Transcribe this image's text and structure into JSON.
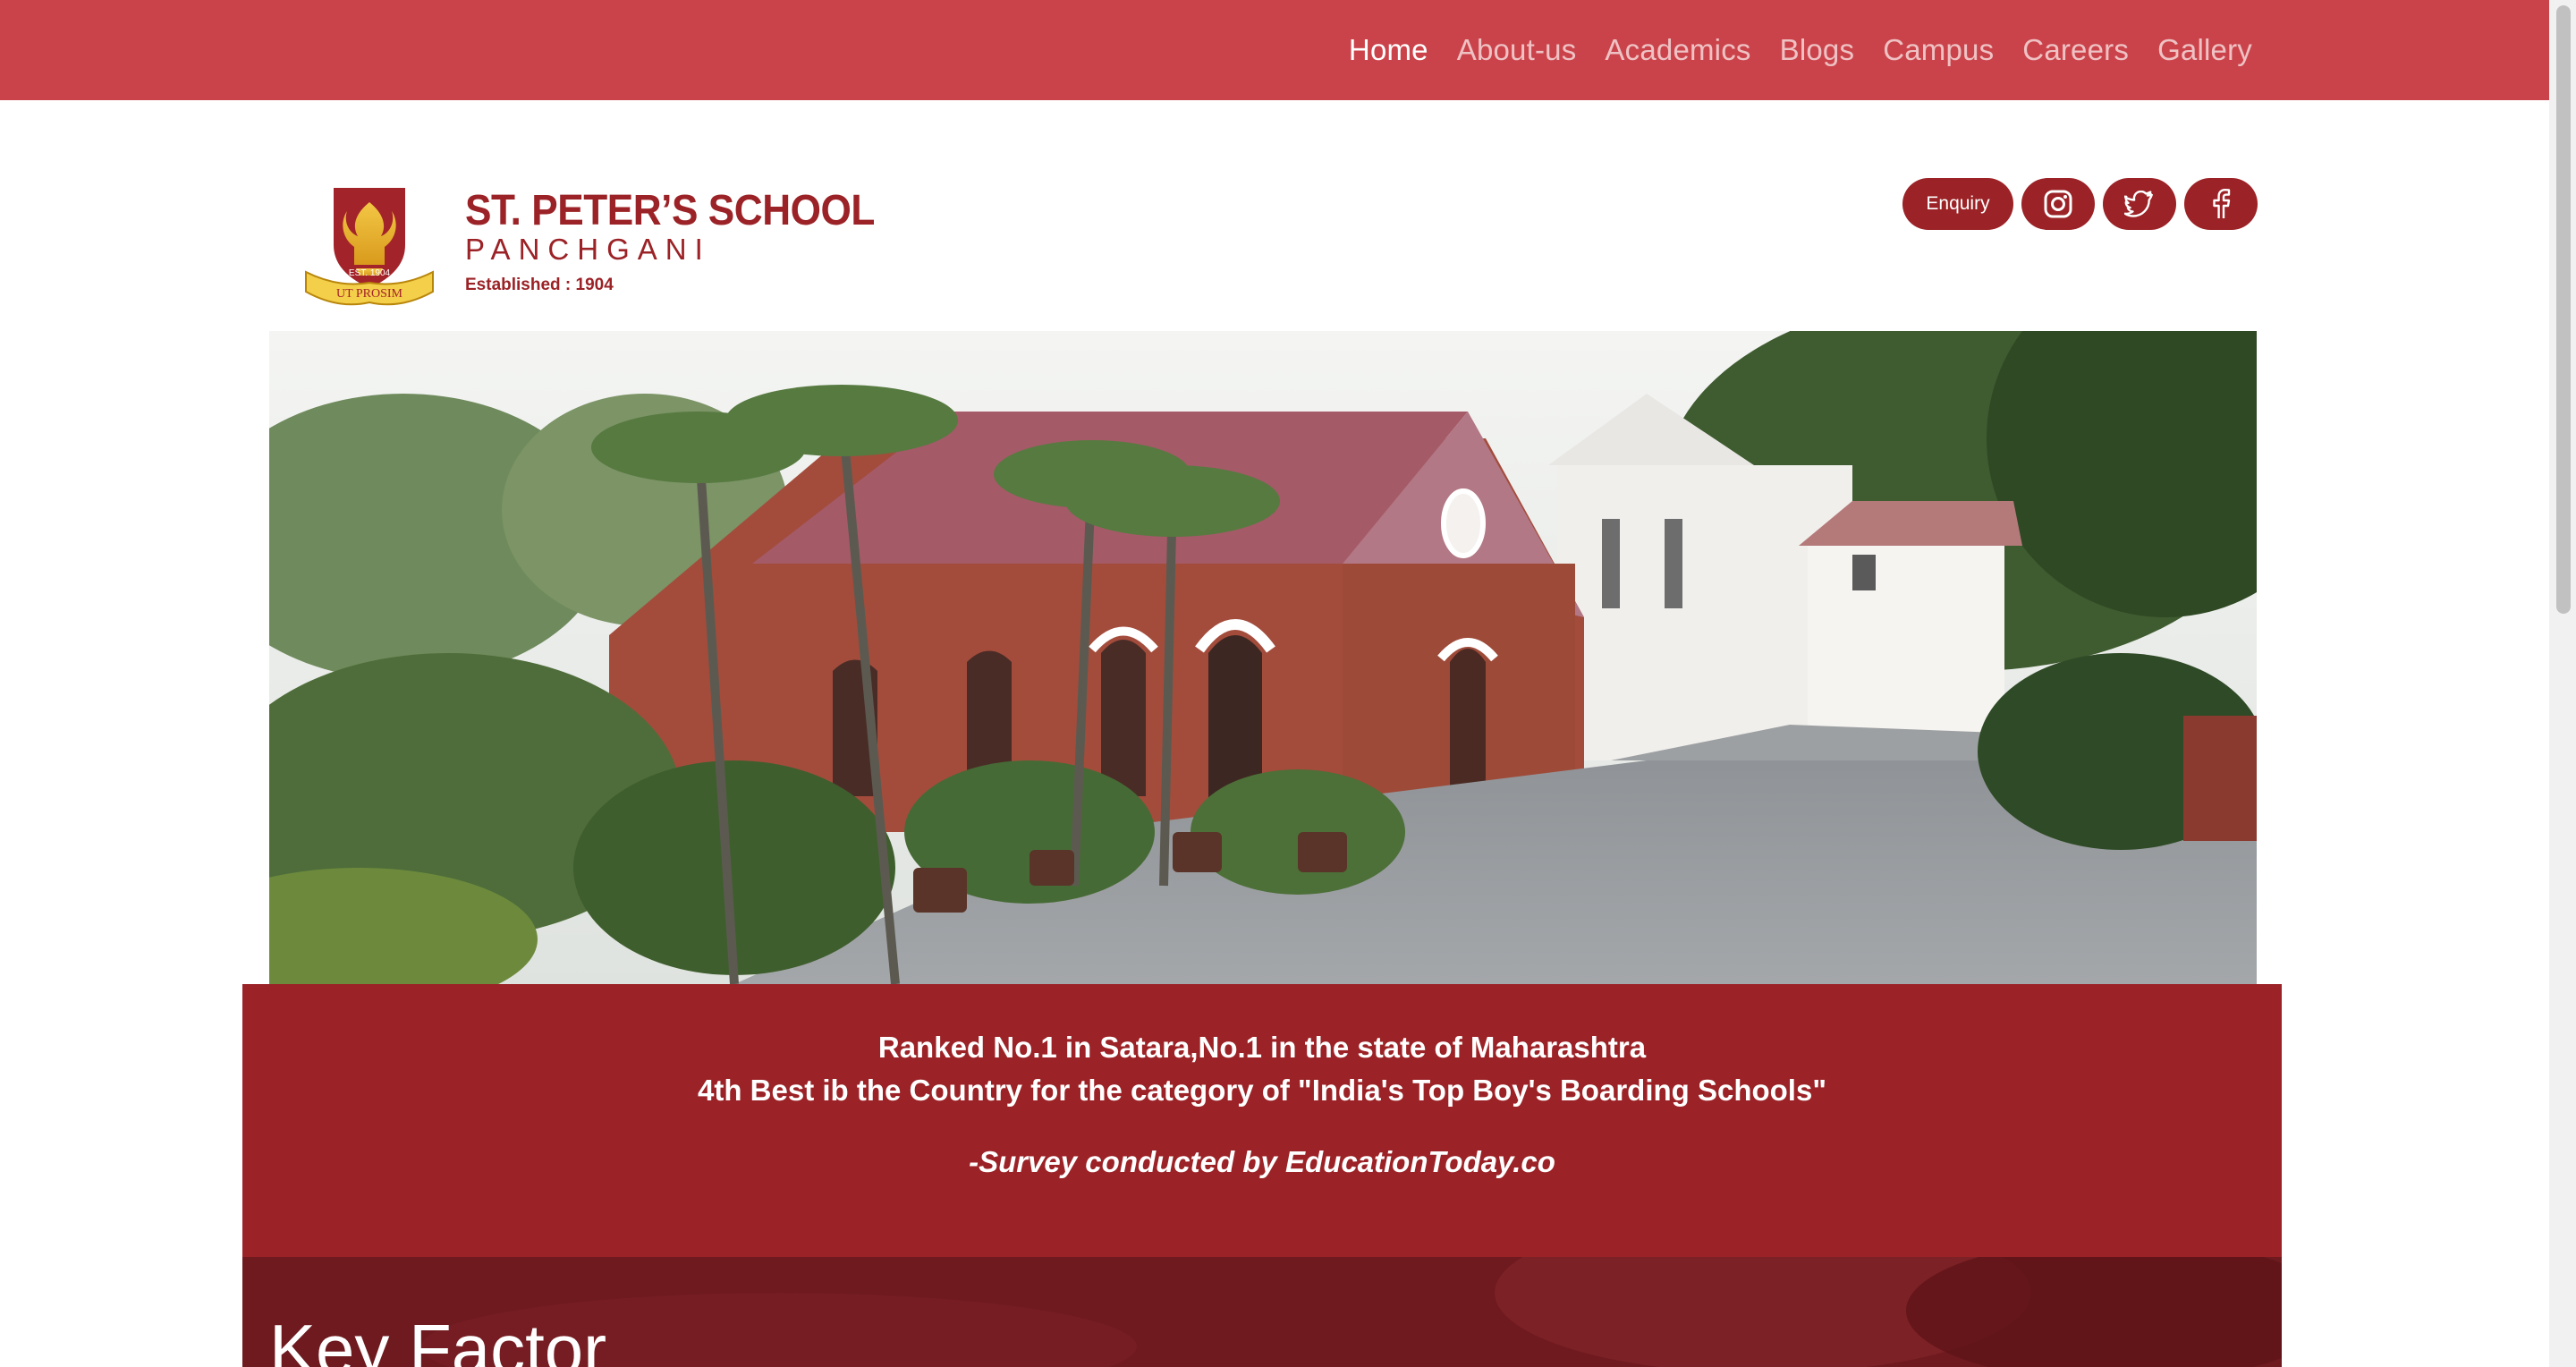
{
  "nav": {
    "items": [
      {
        "label": "Home",
        "active": true
      },
      {
        "label": "About-us"
      },
      {
        "label": "Academics"
      },
      {
        "label": "Blogs"
      },
      {
        "label": "Campus"
      },
      {
        "label": "Careers"
      },
      {
        "label": "Gallery"
      }
    ]
  },
  "header": {
    "school_name": "ST. PETER’S SCHOOL",
    "location": "PANCHGANI",
    "established": "Established : 1904",
    "crest_text": "UT PROSIM",
    "crest_est": "EST. 1904",
    "enquiry_label": "Enquiry",
    "icons": [
      "instagram-icon",
      "twitter-icon",
      "facebook-icon"
    ]
  },
  "banner": {
    "line1": "Ranked No.1 in Satara,No.1 in the state of Maharashtra",
    "line2": "4th Best ib the Country for the category of \"India's Top Boy's Boarding Schools\"",
    "line3": "-Survey conducted by EducationToday.co"
  },
  "key_factor": {
    "heading": "Key Factor"
  },
  "colors": {
    "navbar": "#cb434a",
    "brand": "#9b2226",
    "key_factor_bg": "#7a1a1f"
  }
}
